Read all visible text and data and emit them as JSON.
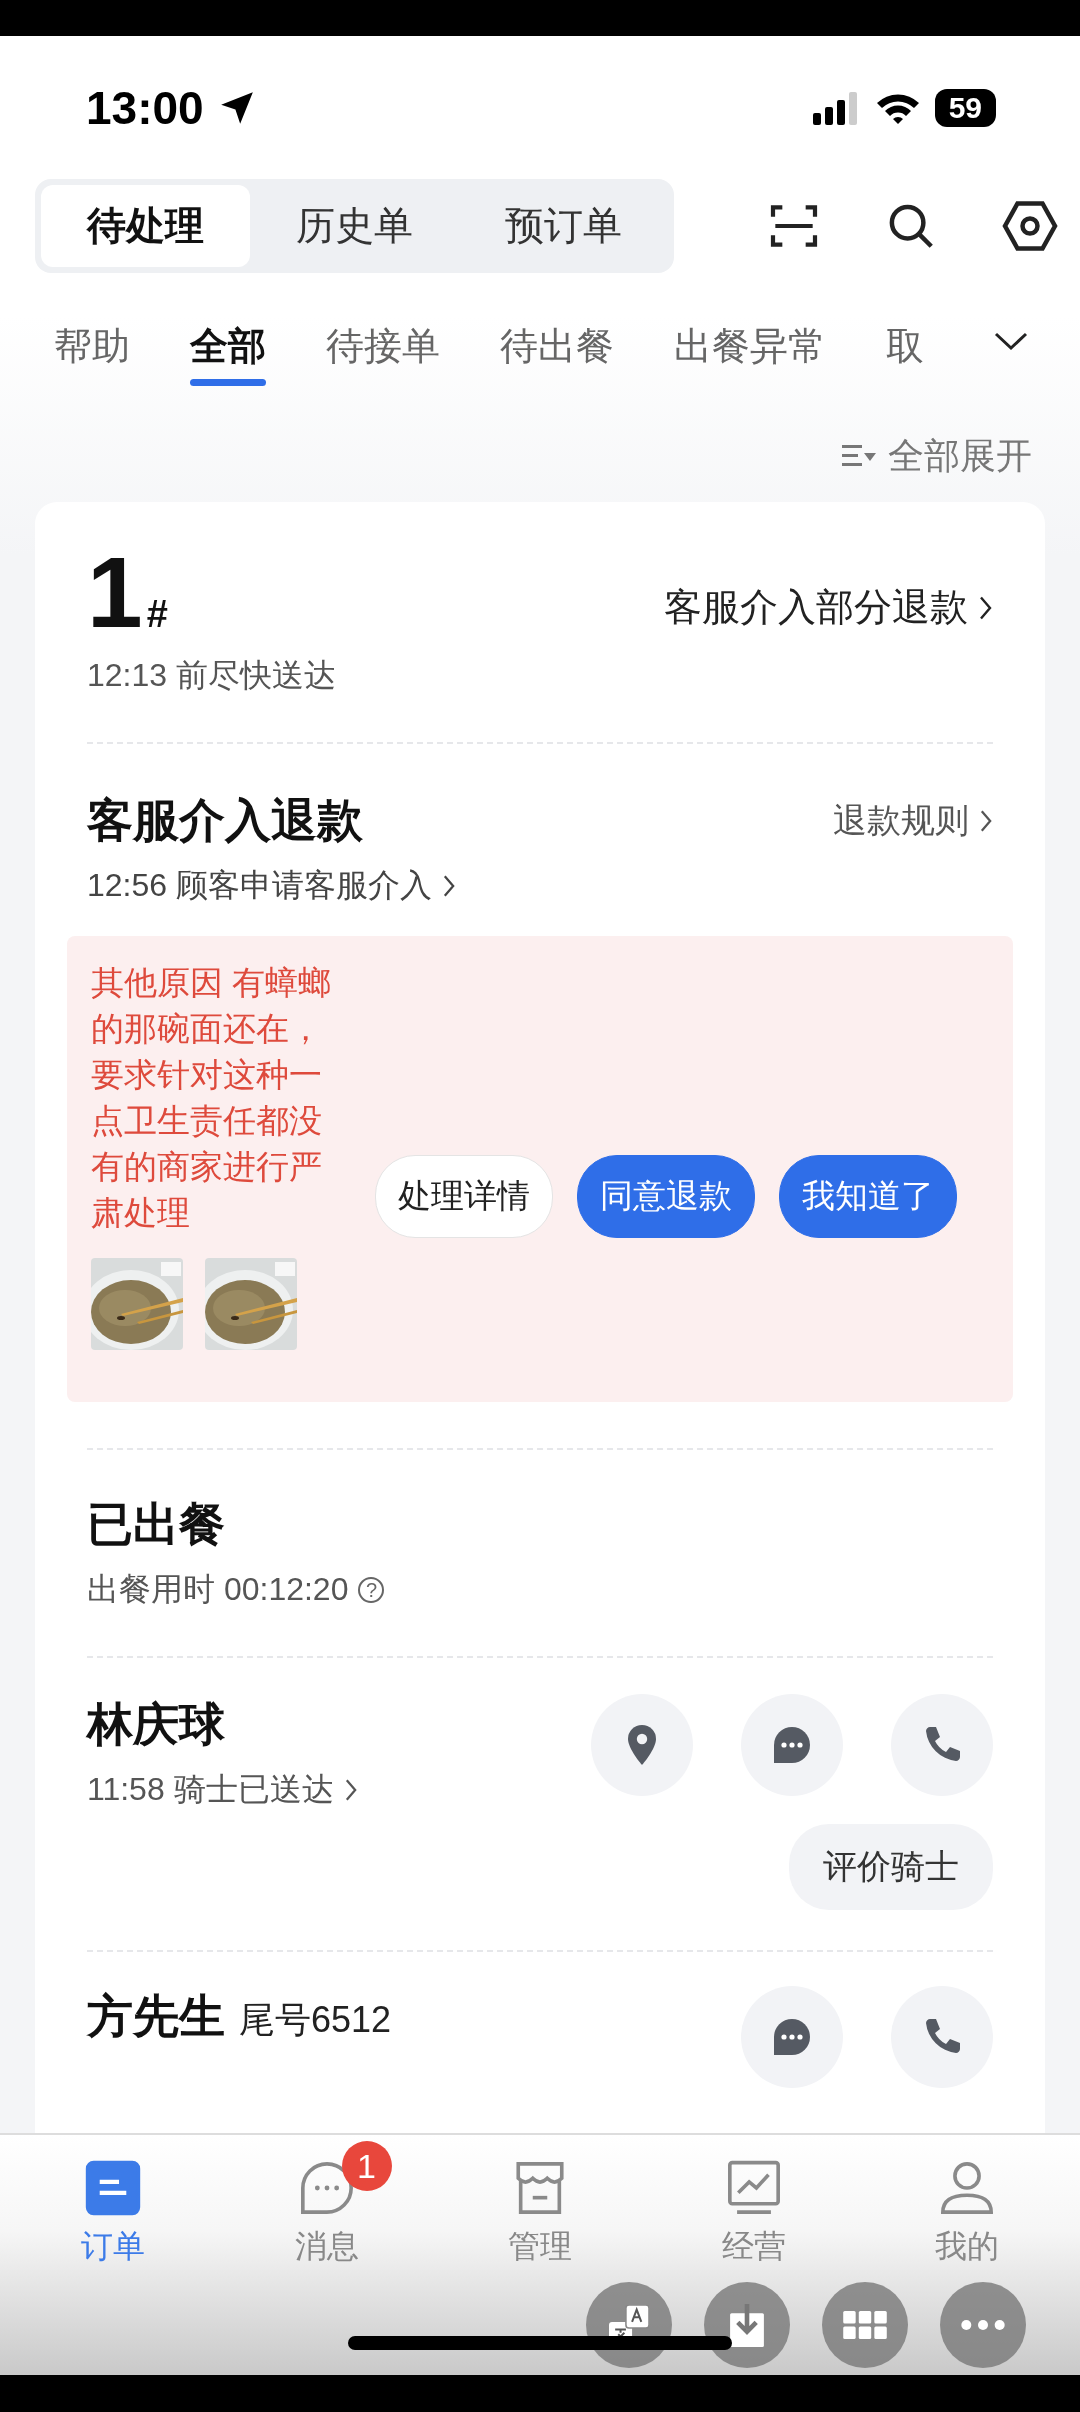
{
  "status_bar": {
    "time": "13:00",
    "battery": "59"
  },
  "segments": [
    {
      "label": "待处理",
      "selected": true
    },
    {
      "label": "历史单",
      "selected": false
    },
    {
      "label": "预订单",
      "selected": false
    }
  ],
  "filter_tabs": [
    {
      "label": "帮助",
      "selected": false
    },
    {
      "label": "全部",
      "selected": true
    },
    {
      "label": "待接单",
      "selected": false
    },
    {
      "label": "待出餐",
      "selected": false
    },
    {
      "label": "出餐异常",
      "selected": false
    },
    {
      "label": "取",
      "selected": false
    }
  ],
  "expand_all": "全部展开",
  "order": {
    "number": "1",
    "hash": "#",
    "eta": "12:13 前尽快送达",
    "status_link": "客服介入部分退款",
    "refund": {
      "title": "客服介入退款",
      "rules_link": "退款规则",
      "applied": "12:56 顾客申请客服介入",
      "reason": "其他原因 有蟑螂的那碗面还在，要求针对这种一点卫生责任都没有的商家进行严肃处理",
      "actions": [
        {
          "label": "处理详情",
          "kind": "secondary"
        },
        {
          "label": "同意退款",
          "kind": "primary"
        },
        {
          "label": "我知道了",
          "kind": "primary"
        }
      ]
    },
    "meal": {
      "title": "已出餐",
      "duration": "出餐用时 00:12:20",
      "help": "?"
    },
    "rider": {
      "name": "林庆球",
      "status": "11:58 骑士已送达",
      "actions": [
        {
          "kind": "location"
        },
        {
          "kind": "chat"
        },
        {
          "kind": "phone"
        }
      ],
      "rate_button": "评价骑士"
    },
    "customer": {
      "name": "方先生",
      "tail": "尾号6512",
      "actions": [
        {
          "kind": "chat"
        },
        {
          "kind": "phone"
        }
      ]
    }
  },
  "bottom_nav": [
    {
      "label": "订单",
      "kind": "orders",
      "selected": true
    },
    {
      "label": "消息",
      "kind": "messages",
      "selected": false,
      "badge": "1"
    },
    {
      "label": "管理",
      "kind": "store",
      "selected": false
    },
    {
      "label": "经营",
      "kind": "chart",
      "selected": false
    },
    {
      "label": "我的",
      "kind": "profile",
      "selected": false
    }
  ],
  "float_tools": [
    {
      "kind": "translate"
    },
    {
      "kind": "download"
    },
    {
      "kind": "grid"
    },
    {
      "kind": "more"
    }
  ]
}
